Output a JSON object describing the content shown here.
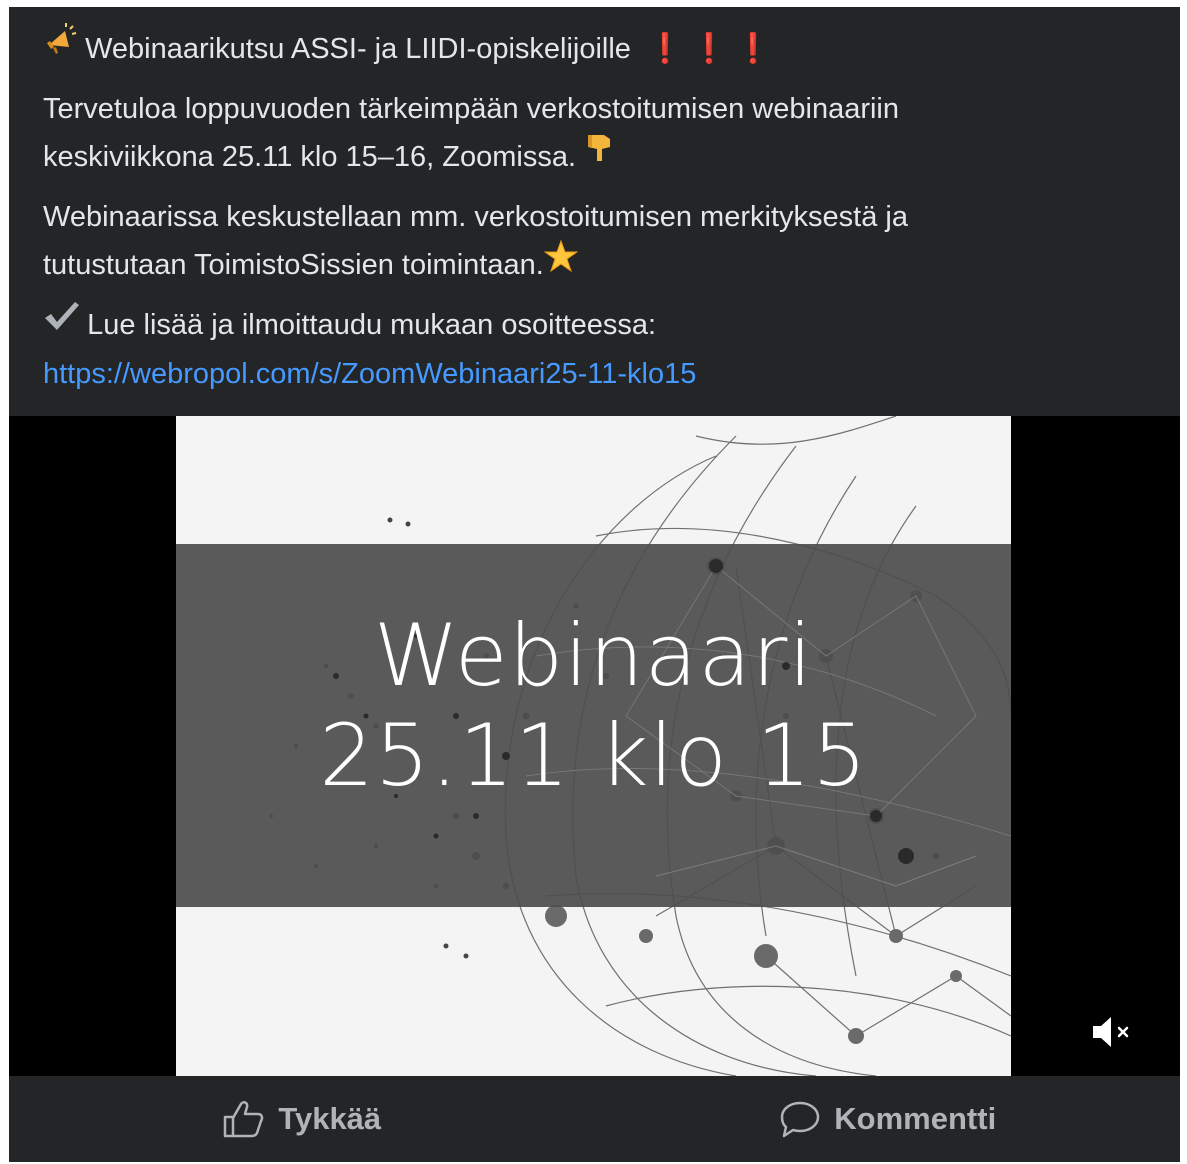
{
  "post": {
    "title_line": "Webinaarikutsu ASSI- ja LIIDI-opiskelijoille",
    "title_icon": "megaphone-icon",
    "exclamation": "❗ ❗ ❗",
    "para1_line1": "Tervetuloa loppuvuoden tärkeimpään verkostoitumisen webinaariin",
    "para1_line2": "keskiviikkona 25.11 klo 15–16, Zoomissa.",
    "para1_emoji": "pointing-down-icon",
    "para2_line1": "Webinaarissa keskustellaan mm. verkostoitumisen merkityksestä ja",
    "para2_line2": "tutustutaan ToimistoSissien toimintaan.",
    "para2_emoji": "star-icon",
    "para3_line1": "Lue lisää ja ilmoittaudu mukaan osoitteessa:",
    "para3_emoji": "check-mark-icon",
    "link": "https://webropol.com/s/ZoomWebinaari25-11-klo15"
  },
  "media": {
    "title_line1": "Webinaari",
    "title_line2": "25.11 klo 15",
    "mute_icon": "speaker-muted-icon"
  },
  "actions": {
    "like_label": "Tykkää",
    "comment_label": "Kommentti"
  },
  "colors": {
    "background": "#242526",
    "text": "#e4e6eb",
    "link": "#4599ff",
    "action_text": "#b0b3b8"
  }
}
